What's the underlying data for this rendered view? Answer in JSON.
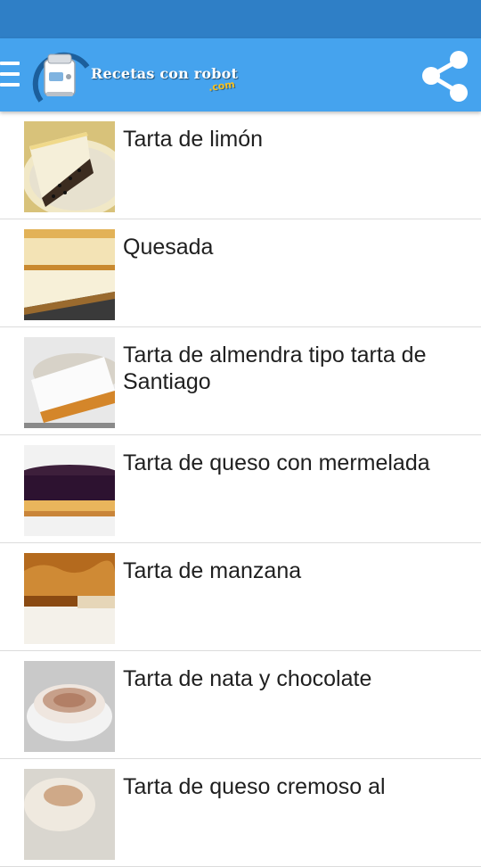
{
  "app": {
    "logo_text": "Recetas con robot",
    "logo_suffix": ".com",
    "colors": {
      "statusbar": "#2f7fc6",
      "appbar": "#45a3ee",
      "divider": "#dcdcdc",
      "text": "#1f1f1f"
    },
    "icons": {
      "menu": "menu-icon",
      "share": "share-icon"
    }
  },
  "recipes": [
    {
      "title": "Tarta de limón",
      "thumb": "lemon-tart-photo"
    },
    {
      "title": "Quesada",
      "thumb": "quesada-photo"
    },
    {
      "title": "Tarta de almendra tipo tarta de Santiago",
      "thumb": "almond-tart-photo"
    },
    {
      "title": "Tarta de queso con mermelada",
      "thumb": "cheesecake-jam-photo"
    },
    {
      "title": "Tarta de manzana",
      "thumb": "apple-tart-photo"
    },
    {
      "title": "Tarta de nata y chocolate",
      "thumb": "cream-chocolate-tart-photo"
    },
    {
      "title": "Tarta de queso cremoso al",
      "thumb": "creamy-cheesecake-photo"
    }
  ]
}
